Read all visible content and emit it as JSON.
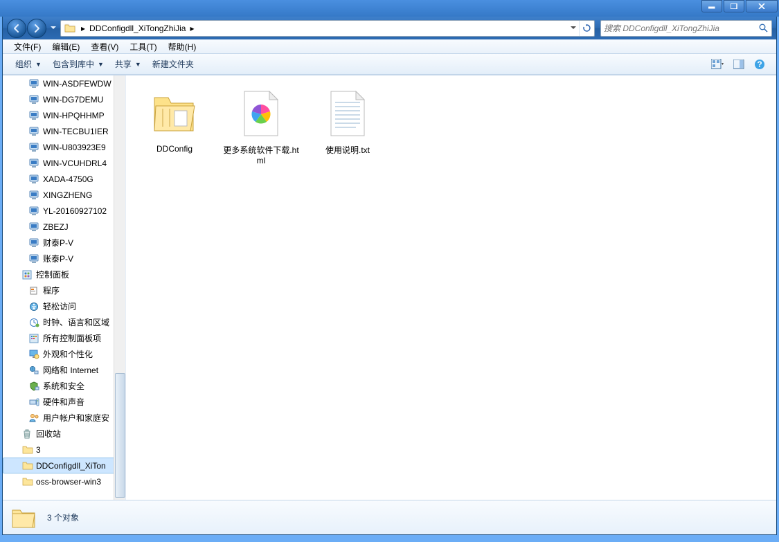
{
  "title_buttons": {
    "min": "min",
    "max": "max",
    "close": "close"
  },
  "breadcrumb": {
    "root": "",
    "current": "DDConfigdll_XiTongZhiJia"
  },
  "search": {
    "placeholder": "搜索 DDConfigdll_XiTongZhiJia"
  },
  "menu": {
    "file": "文件(F)",
    "edit": "编辑(E)",
    "view": "查看(V)",
    "tools": "工具(T)",
    "help": "帮助(H)"
  },
  "toolbar": {
    "organize": "组织",
    "include": "包含到库中",
    "share": "共享",
    "newfolder": "新建文件夹"
  },
  "tree": [
    {
      "label": "WIN-ASDFEWDW",
      "icon": "pc",
      "lvl": "lvl2"
    },
    {
      "label": "WIN-DG7DEMU",
      "icon": "pc",
      "lvl": "lvl2"
    },
    {
      "label": "WIN-HPQHHMP",
      "icon": "pc",
      "lvl": "lvl2"
    },
    {
      "label": "WIN-TECBU1IER",
      "icon": "pc",
      "lvl": "lvl2"
    },
    {
      "label": "WIN-U803923E9",
      "icon": "pc",
      "lvl": "lvl2"
    },
    {
      "label": "WIN-VCUHDRL4",
      "icon": "pc",
      "lvl": "lvl2"
    },
    {
      "label": "XADA-4750G",
      "icon": "pc",
      "lvl": "lvl2"
    },
    {
      "label": "XINGZHENG",
      "icon": "pc",
      "lvl": "lvl2"
    },
    {
      "label": "YL-20160927102",
      "icon": "pc",
      "lvl": "lvl2"
    },
    {
      "label": "ZBEZJ",
      "icon": "pc",
      "lvl": "lvl2"
    },
    {
      "label": "财泰P-V",
      "icon": "pc",
      "lvl": "lvl2"
    },
    {
      "label": "账泰P-V",
      "icon": "pc",
      "lvl": "lvl2"
    },
    {
      "label": "控制面板",
      "icon": "cpanel",
      "lvl": "lvl1"
    },
    {
      "label": "程序",
      "icon": "programs",
      "lvl": "lvl3"
    },
    {
      "label": "轻松访问",
      "icon": "ease",
      "lvl": "lvl3"
    },
    {
      "label": "时钟、语言和区域",
      "icon": "clock",
      "lvl": "lvl3"
    },
    {
      "label": "所有控制面板项",
      "icon": "allcp",
      "lvl": "lvl3"
    },
    {
      "label": "外观和个性化",
      "icon": "appearance",
      "lvl": "lvl3"
    },
    {
      "label": "网络和 Internet",
      "icon": "network",
      "lvl": "lvl3"
    },
    {
      "label": "系统和安全",
      "icon": "security",
      "lvl": "lvl3"
    },
    {
      "label": "硬件和声音",
      "icon": "hardware",
      "lvl": "lvl3"
    },
    {
      "label": "用户帐户和家庭安",
      "icon": "users",
      "lvl": "lvl3"
    },
    {
      "label": "回收站",
      "icon": "recycle",
      "lvl": "lvl1"
    },
    {
      "label": "3",
      "icon": "folder",
      "lvl": "lvl1"
    },
    {
      "label": "DDConfigdll_XiTon",
      "icon": "folder",
      "lvl": "lvl1",
      "selected": true
    },
    {
      "label": "oss-browser-win3",
      "icon": "folder",
      "lvl": "lvl1"
    }
  ],
  "files": [
    {
      "name": "DDConfig",
      "type": "folder"
    },
    {
      "name": "更多系统软件下载.html",
      "type": "html"
    },
    {
      "name": "使用说明.txt",
      "type": "txt"
    }
  ],
  "status": {
    "count": "3 个对象"
  }
}
